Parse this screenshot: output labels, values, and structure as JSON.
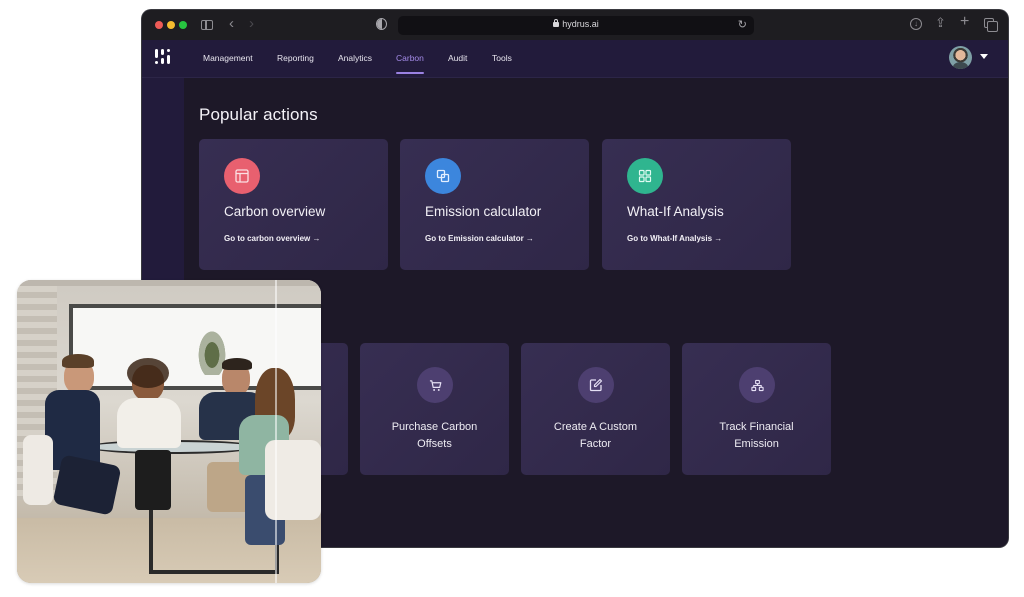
{
  "browser": {
    "url": "hydrus.ai",
    "icons": [
      "traffic-lights",
      "sidebar-toggle-icon",
      "back-icon",
      "forward-icon",
      "privacy-shield-icon",
      "lock-icon",
      "reload-icon",
      "download-icon",
      "share-icon",
      "new-tab-icon",
      "tab-overview-icon"
    ],
    "back_glyph": "‹",
    "forward_glyph": "›",
    "reload_glyph": "↻",
    "download_glyph": "↓",
    "share_glyph": "⇪",
    "plus_glyph": "+"
  },
  "nav": {
    "logo": "hydrus-logo",
    "items": [
      {
        "label": "Management",
        "active": false
      },
      {
        "label": "Reporting",
        "active": false
      },
      {
        "label": "Analytics",
        "active": false
      },
      {
        "label": "Carbon",
        "active": true
      },
      {
        "label": "Audit",
        "active": false
      },
      {
        "label": "Tools",
        "active": false
      }
    ],
    "active_color": "#a48be8",
    "user_menu": {
      "avatar": "user-avatar",
      "icon": "caret-down-icon"
    }
  },
  "main": {
    "section_title": "Popular actions",
    "popular_actions": [
      {
        "title": "Carbon overview",
        "link": "Go to carbon overview →",
        "icon": "layout-icon",
        "icon_color": "#e8606f"
      },
      {
        "title": "Emission calculator",
        "link": "Go to Emission calculator →",
        "icon": "copy-squares-icon",
        "icon_color": "#3c86dd"
      },
      {
        "title": "What-If Analysis",
        "link": "Go to What-If Analysis →",
        "icon": "grid-icon",
        "icon_color": "#2fb58f"
      }
    ],
    "more_actions": [
      {
        "title": "",
        "icon": ""
      },
      {
        "title": "Purchase Carbon Offsets",
        "icon": "cart-icon"
      },
      {
        "title": "Create A Custom Factor",
        "icon": "edit-icon"
      },
      {
        "title": "Track Financial Emission",
        "icon": "hierarchy-icon"
      }
    ]
  },
  "overlay_photo": {
    "description": "Four colleagues in a meeting around a glass table in a bright office"
  },
  "colors": {
    "nav_bg": "#221b3b",
    "content_bg": "#1d1828",
    "card_bg": "#342b4e",
    "small_icon_bg": "#4d3f70"
  }
}
